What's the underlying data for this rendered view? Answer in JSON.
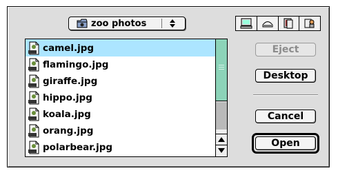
{
  "folder_popup": {
    "label": "zoo photos",
    "icon": "folder-icon"
  },
  "volume_icons": [
    {
      "name": "computer-icon"
    },
    {
      "name": "drive-icon"
    },
    {
      "name": "document-icon"
    },
    {
      "name": "network-icon"
    }
  ],
  "files": [
    {
      "name": "camel.jpg",
      "selected": true
    },
    {
      "name": "flamingo.jpg",
      "selected": false
    },
    {
      "name": "giraffe.jpg",
      "selected": false
    },
    {
      "name": "hippo.jpg",
      "selected": false
    },
    {
      "name": "koala.jpg",
      "selected": false
    },
    {
      "name": "orang.jpg",
      "selected": false
    },
    {
      "name": "polarbear.jpg",
      "selected": false
    }
  ],
  "buttons": {
    "eject": "Eject",
    "desktop": "Desktop",
    "cancel": "Cancel",
    "open": "Open"
  },
  "colors": {
    "selection": "#ace5ff",
    "scroll_thumb": "#8cd3b8",
    "dialog": "#dddddd"
  }
}
